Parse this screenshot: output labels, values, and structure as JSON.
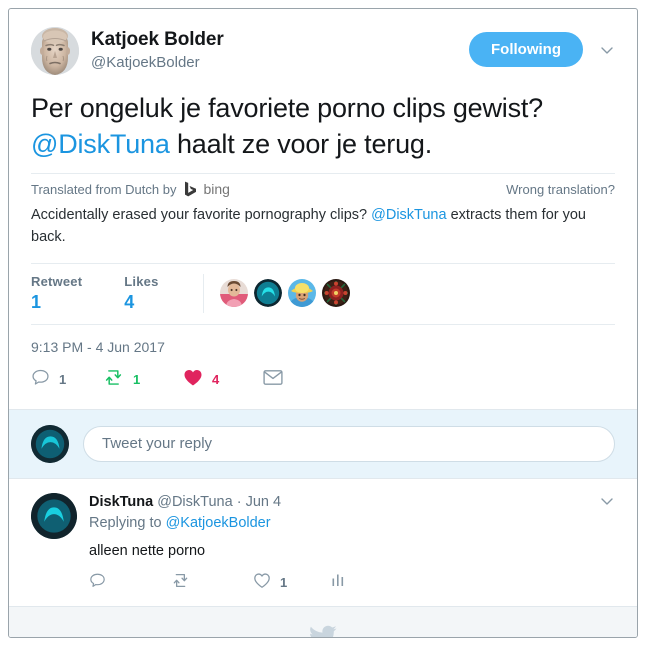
{
  "main_tweet": {
    "display_name": "Katjoek Bolder",
    "handle": "@KatjoekBolder",
    "avatar_name": "katjoek-bolder-avatar",
    "follow_button_label": "Following",
    "caret_icon": "chevron-down-icon",
    "text_line1_pre": "Per ongeluk je favoriete porno clips gewist?",
    "text_mention": "@DiskTuna",
    "text_line2_post": " haalt ze voor je terug.",
    "translation": {
      "source_label": "Translated from Dutch by",
      "provider": "bing",
      "provider_icon": "bing-logo-icon",
      "wrong_translation_label": "Wrong translation?",
      "body_pre": "Accidentally erased your favorite pornography clips? ",
      "body_mention": "@DiskTuna",
      "body_post": " extracts them for you back."
    },
    "stats": {
      "retweet_label": "Retweet",
      "retweet_value": "1",
      "likes_label": "Likes",
      "likes_value": "4",
      "facepile": [
        {
          "name": "liker-avatar-1"
        },
        {
          "name": "liker-avatar-2"
        },
        {
          "name": "liker-avatar-3"
        },
        {
          "name": "liker-avatar-4"
        }
      ]
    },
    "timestamp": "9:13 PM - 4 Jun 2017",
    "actions": {
      "reply_icon": "reply-icon",
      "reply_count": "1",
      "retweet_icon": "retweet-icon",
      "retweet_count": "1",
      "like_icon": "heart-icon",
      "like_count": "4",
      "dm_icon": "envelope-icon"
    }
  },
  "composer": {
    "avatar_name": "disktuna-avatar",
    "placeholder": "Tweet your reply"
  },
  "reply_tweet": {
    "avatar_name": "disktuna-avatar",
    "display_name": "DiskTuna",
    "handle": "@DiskTuna",
    "separator": "·",
    "date": "Jun 4",
    "caret_icon": "chevron-down-icon",
    "replying_to_label": "Replying to ",
    "replying_to_mention": "@KatjoekBolder",
    "text": "alleen nette porno",
    "actions": {
      "reply_icon": "reply-icon",
      "retweet_icon": "retweet-icon",
      "like_icon": "heart-outline-icon",
      "like_count": "1",
      "analytics_icon": "analytics-bars-icon"
    }
  },
  "footer": {
    "logo_icon": "twitter-bird-icon"
  },
  "colors": {
    "brand_blue": "#1b95e0",
    "follow_blue": "#4ab3f4",
    "retweet_green": "#17bf63",
    "like_red": "#e0245e",
    "muted_gray": "#657786",
    "divider": "#e6ecf0",
    "composer_bg": "#e8f4fb",
    "footer_bg": "#f3f6f8"
  }
}
